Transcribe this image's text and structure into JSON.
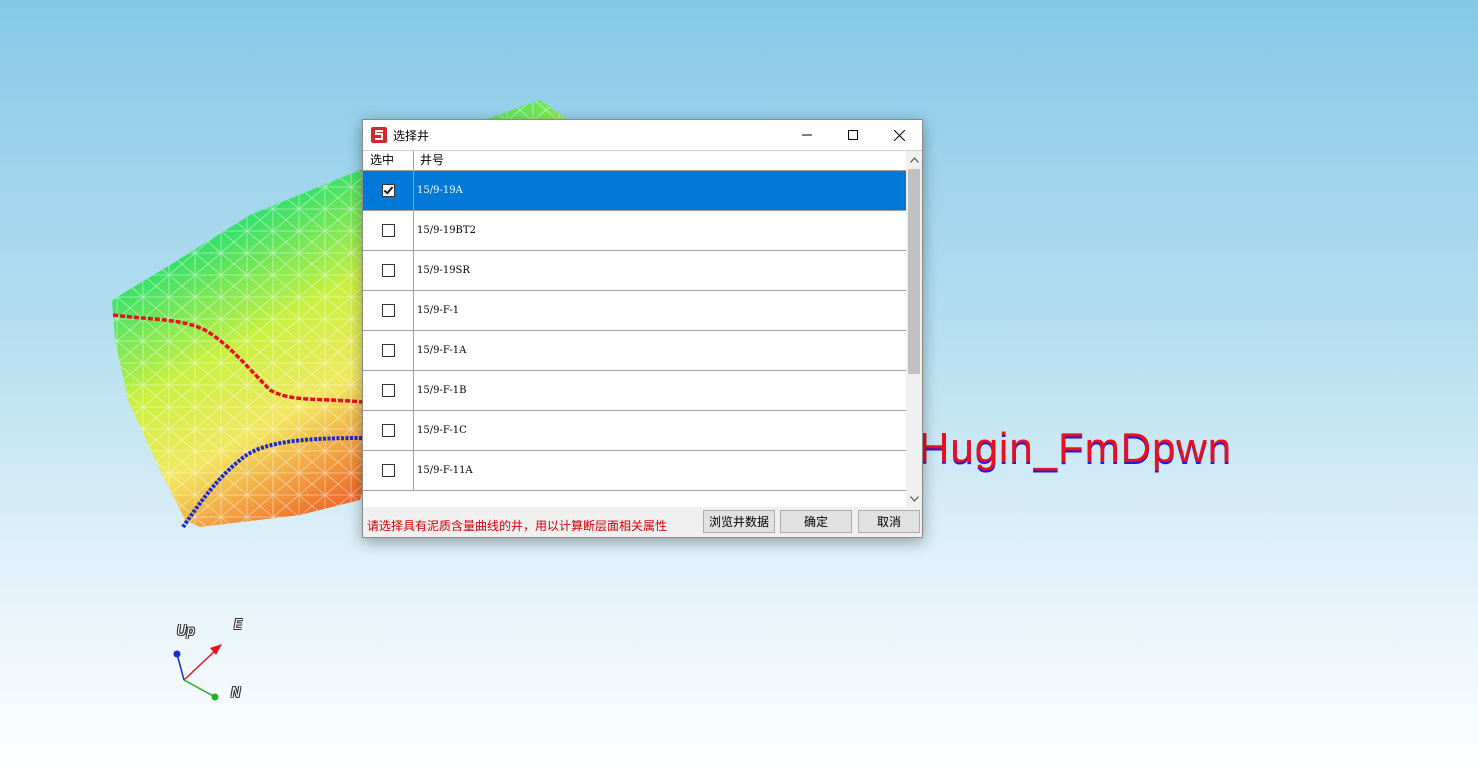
{
  "overlay": {
    "label_red": "Hugin_FmDpwn",
    "label_blue": "Hugin_FmDpwn"
  },
  "axes": {
    "up": "Up",
    "east": "E",
    "north": "N"
  },
  "dialog": {
    "title": "选择井",
    "app_icon": "app-logo-icon",
    "columns": {
      "selected": "选中",
      "well_name": "井号"
    },
    "rows": [
      {
        "name": "15/9-19A",
        "checked": true,
        "selected": true
      },
      {
        "name": "15/9-19BT2",
        "checked": false,
        "selected": false
      },
      {
        "name": "15/9-19SR",
        "checked": false,
        "selected": false
      },
      {
        "name": "15/9-F-1",
        "checked": false,
        "selected": false
      },
      {
        "name": "15/9-F-1A",
        "checked": false,
        "selected": false
      },
      {
        "name": "15/9-F-1B",
        "checked": false,
        "selected": false
      },
      {
        "name": "15/9-F-1C",
        "checked": false,
        "selected": false
      },
      {
        "name": "15/9-F-11A",
        "checked": false,
        "selected": false
      }
    ],
    "hint": "请选择具有泥质含量曲线的井，用以计算断层面相关属性",
    "buttons": {
      "browse": "浏览井数据",
      "ok": "确定",
      "cancel": "取消"
    }
  },
  "colors": {
    "selection": "#0078d7",
    "hint_text": "#d40000",
    "curve_red": "#e8101e",
    "curve_blue": "#1a2ad0"
  }
}
